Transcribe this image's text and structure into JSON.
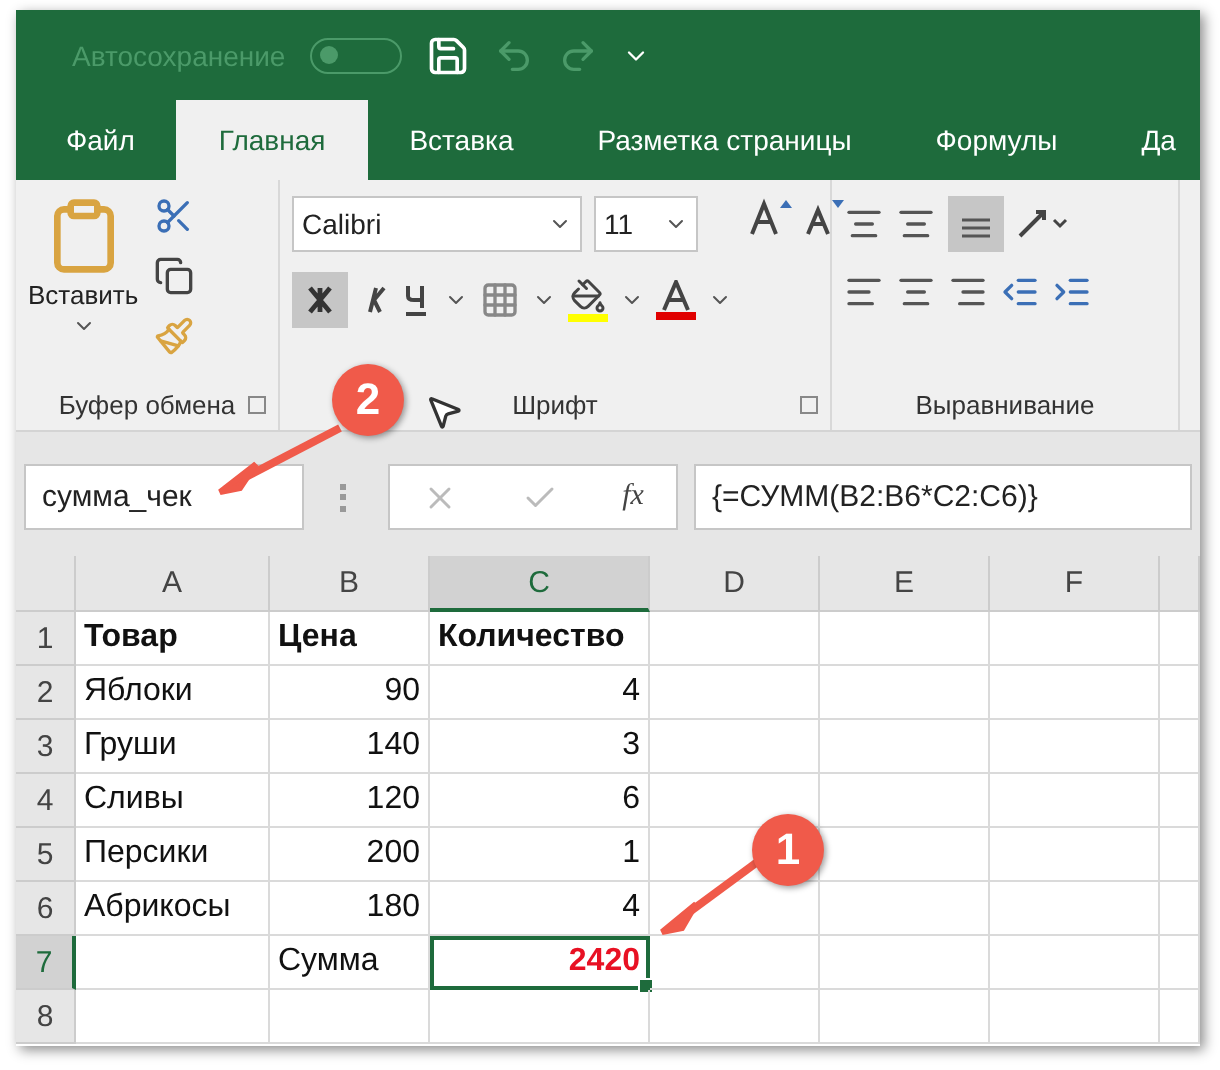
{
  "quick_access": {
    "autosave_label": "Автосохранение",
    "autosave_on": false
  },
  "tabs": [
    {
      "label": "Файл",
      "selected": false
    },
    {
      "label": "Главная",
      "selected": true
    },
    {
      "label": "Вставка",
      "selected": false
    },
    {
      "label": "Разметка страницы",
      "selected": false
    },
    {
      "label": "Формулы",
      "selected": false
    },
    {
      "label": "Да",
      "selected": false
    }
  ],
  "ribbon": {
    "paste_label": "Вставить",
    "font_name": "Calibri",
    "font_size": "11",
    "bold_on": true,
    "groups": [
      "Буфер обмена",
      "Шрифт",
      "Выравнивание"
    ]
  },
  "formula_bar": {
    "name_box": "сумма_чек",
    "fx_label": "fx",
    "formula": "{=СУММ(B2:B6*C2:C6)}"
  },
  "sheet": {
    "columns": [
      {
        "label": "A",
        "selected": false
      },
      {
        "label": "B",
        "selected": false
      },
      {
        "label": "C",
        "selected": true
      },
      {
        "label": "D",
        "selected": false
      },
      {
        "label": "E",
        "selected": false
      },
      {
        "label": "F",
        "selected": false
      }
    ],
    "rows": [
      {
        "number": "1",
        "selected": false,
        "cells": [
          {
            "text": "Товар",
            "kind": "header"
          },
          {
            "text": "Цена",
            "kind": "header"
          },
          {
            "text": "Количество",
            "kind": "header"
          }
        ]
      },
      {
        "number": "2",
        "selected": false,
        "cells": [
          {
            "text": "Яблоки",
            "kind": "text"
          },
          {
            "text": "90",
            "kind": "number"
          },
          {
            "text": "4",
            "kind": "number"
          }
        ]
      },
      {
        "number": "3",
        "selected": false,
        "cells": [
          {
            "text": "Груши",
            "kind": "text"
          },
          {
            "text": "140",
            "kind": "number"
          },
          {
            "text": "3",
            "kind": "number"
          }
        ]
      },
      {
        "number": "4",
        "selected": false,
        "cells": [
          {
            "text": "Сливы",
            "kind": "text"
          },
          {
            "text": "120",
            "kind": "number"
          },
          {
            "text": "6",
            "kind": "number"
          }
        ]
      },
      {
        "number": "5",
        "selected": false,
        "cells": [
          {
            "text": "Персики",
            "kind": "text"
          },
          {
            "text": "200",
            "kind": "number"
          },
          {
            "text": "1",
            "kind": "number"
          }
        ]
      },
      {
        "number": "6",
        "selected": false,
        "cells": [
          {
            "text": "Абрикосы",
            "kind": "text"
          },
          {
            "text": "180",
            "kind": "number"
          },
          {
            "text": "4",
            "kind": "number"
          }
        ]
      },
      {
        "number": "7",
        "selected": true,
        "cells": [
          {
            "kind": "empty"
          },
          {
            "text": "Сумма",
            "kind": "text"
          },
          {
            "text": "2420",
            "kind": "result",
            "selected": true
          }
        ]
      },
      {
        "number": "8",
        "selected": false,
        "cells": []
      }
    ]
  },
  "annotations": [
    {
      "number": "2"
    },
    {
      "number": "1"
    }
  ]
}
